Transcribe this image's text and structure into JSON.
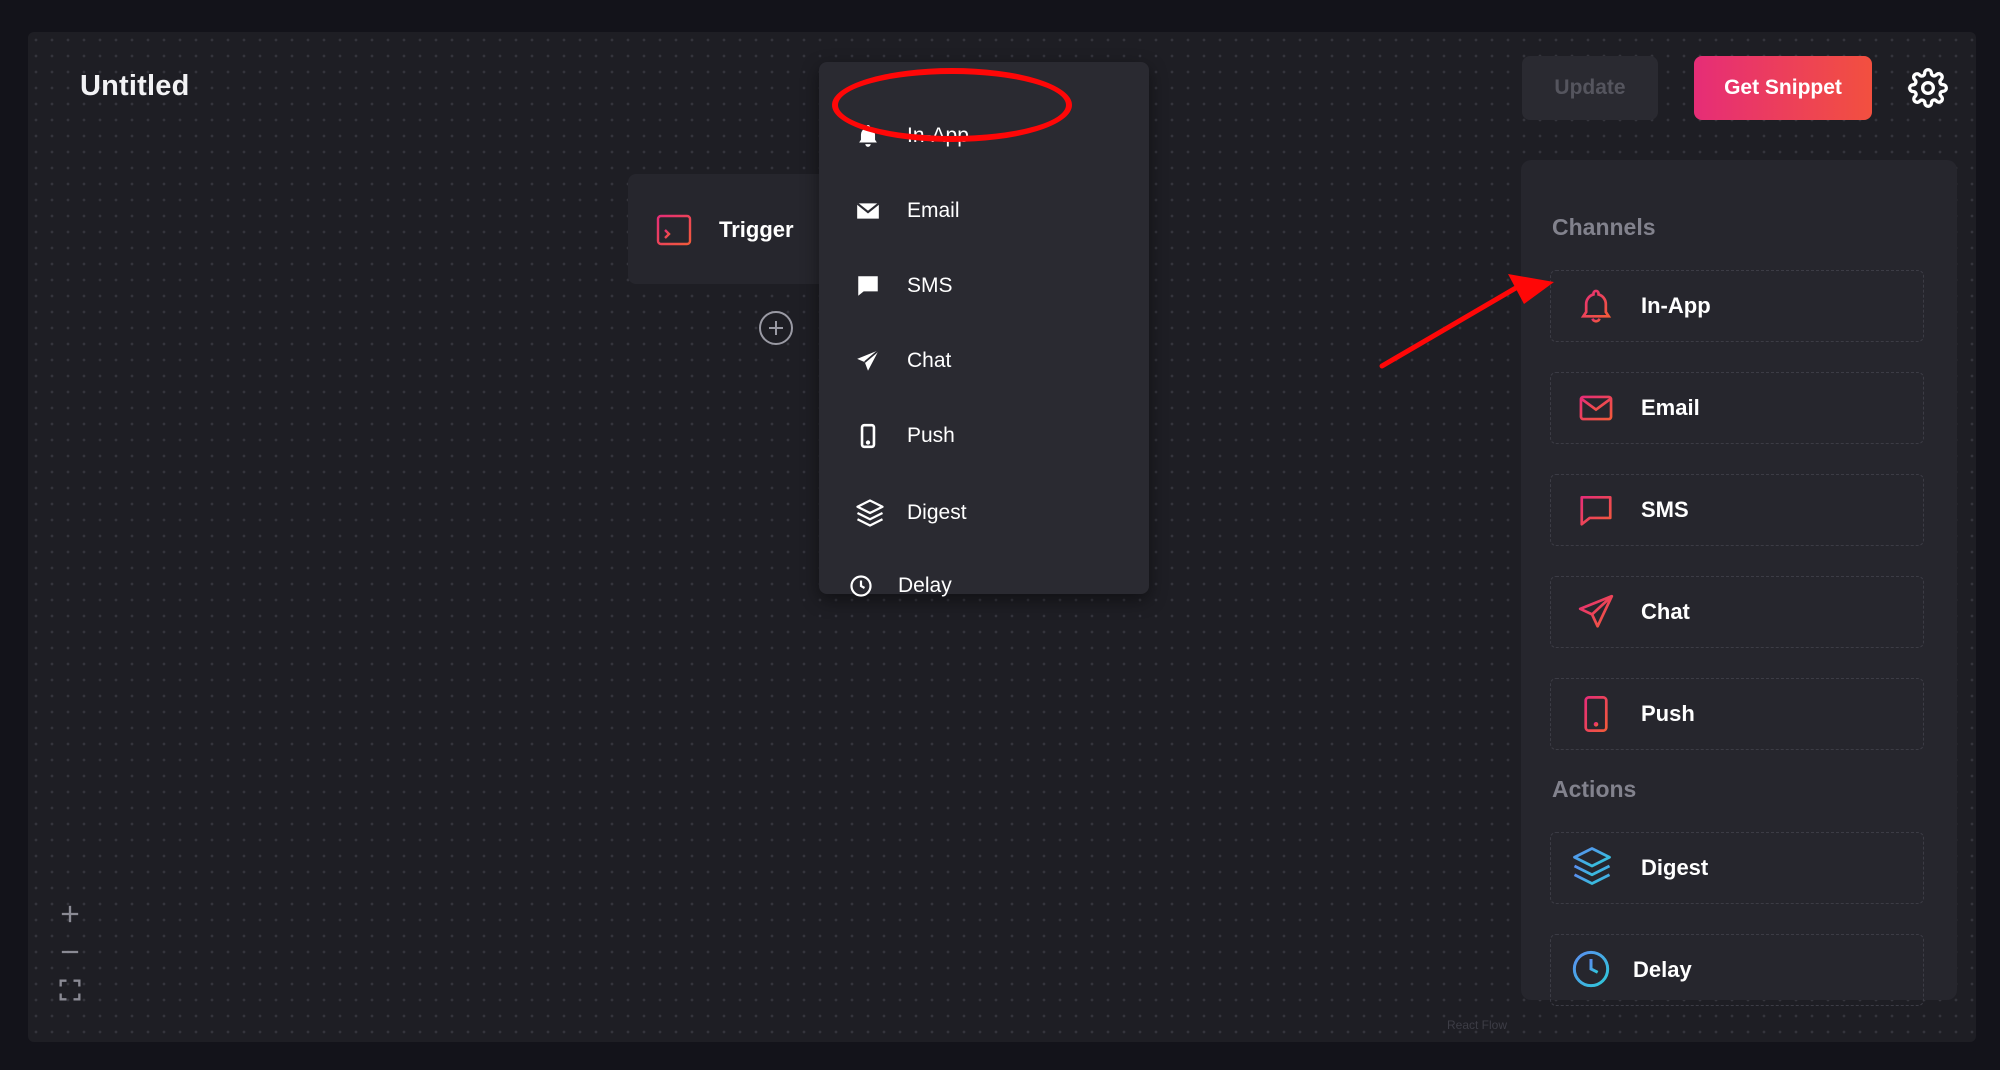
{
  "header": {
    "title": "Untitled",
    "update_label": "Update",
    "snippet_label": "Get Snippet"
  },
  "canvas": {
    "trigger_label": "Trigger",
    "watermark": "React Flow"
  },
  "dropdown": {
    "items": [
      {
        "label": "In-App",
        "icon": "bell-icon"
      },
      {
        "label": "Email",
        "icon": "envelope-icon"
      },
      {
        "label": "SMS",
        "icon": "chat-bubble-icon"
      },
      {
        "label": "Chat",
        "icon": "paper-plane-icon"
      },
      {
        "label": "Push",
        "icon": "mobile-icon"
      },
      {
        "label": "Digest",
        "icon": "layers-icon"
      },
      {
        "label": "Delay",
        "icon": "clock-icon"
      }
    ]
  },
  "panel": {
    "channels_title": "Channels",
    "actions_title": "Actions",
    "channels": [
      {
        "label": "In-App",
        "icon": "bell-icon"
      },
      {
        "label": "Email",
        "icon": "envelope-icon"
      },
      {
        "label": "SMS",
        "icon": "chat-bubble-icon"
      },
      {
        "label": "Chat",
        "icon": "paper-plane-icon"
      },
      {
        "label": "Push",
        "icon": "mobile-icon"
      }
    ],
    "actions": [
      {
        "label": "Digest",
        "icon": "layers-icon"
      },
      {
        "label": "Delay",
        "icon": "clock-icon"
      }
    ]
  },
  "colors": {
    "accent_gradient_start": "#e62d77",
    "accent_gradient_end": "#f2503f",
    "action_blue": "#3aa6e6",
    "annotation_red": "#ff0707"
  }
}
